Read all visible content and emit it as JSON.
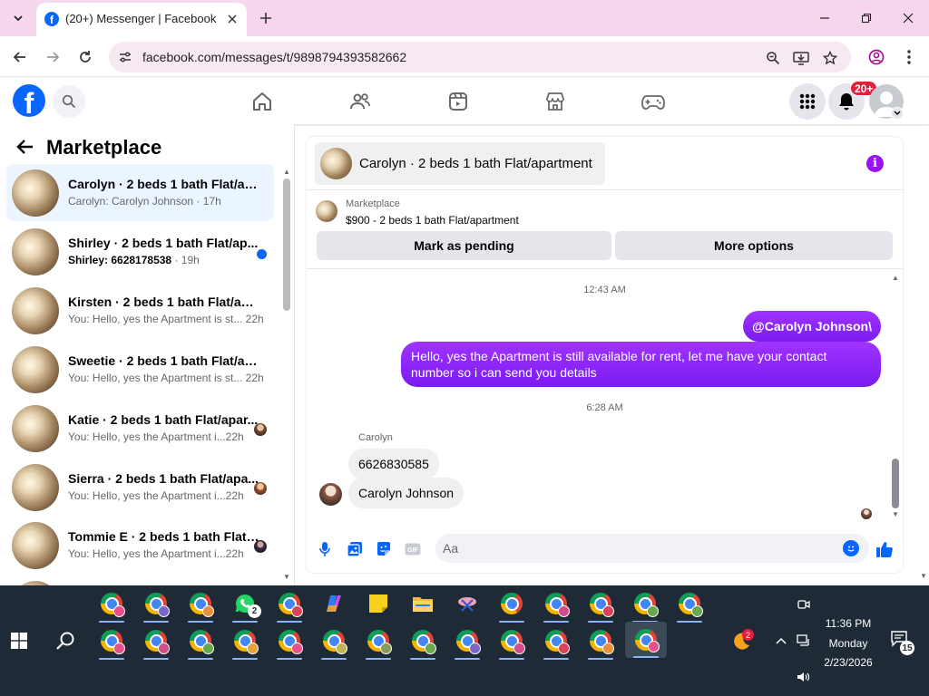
{
  "browser": {
    "tab": {
      "title": "(20+) Messenger | Facebook"
    },
    "url": "facebook.com/messages/t/9898794393582662"
  },
  "fb_header": {
    "notification_badge": "20+",
    "brand_color": "#0866ff"
  },
  "sidebar": {
    "title": "Marketplace",
    "conversations": [
      {
        "name": "Carolyn · 2 beds 1 bath Flat/apa...",
        "preview": "Carolyn: Carolyn Johnson",
        "time": "· 17h",
        "active": true
      },
      {
        "name": "Shirley · 2 beds 1 bath Flat/ap...",
        "preview": "Shirley: 6628178538",
        "time": "· 19h",
        "unread": true
      },
      {
        "name": "Kirsten · 2 beds 1 bath Flat/apar...",
        "preview": "You: Hello, yes the Apartment is st...",
        "time": "22h"
      },
      {
        "name": "Sweetie · 2 beds 1 bath Flat/apa...",
        "preview": "You: Hello, yes the Apartment is st...",
        "time": "22h"
      },
      {
        "name": "Katie · 2 beds 1 bath Flat/apar...",
        "preview": "You: Hello, yes the Apartment i...",
        "time": "22h"
      },
      {
        "name": "Sierra · 2 beds 1 bath Flat/apa...",
        "preview": "You: Hello, yes the Apartment i...",
        "time": "22h"
      },
      {
        "name": "Tommie E · 2 beds 1 bath Flat/...",
        "preview": "You: Hello, yes the Apartment i...",
        "time": "22h"
      }
    ]
  },
  "chat": {
    "title": "Carolyn · 2 beds 1 bath Flat/apartment",
    "marketplace_label": "Marketplace",
    "listing": "$900 - 2 beds 1 bath Flat/apartment",
    "mark_pending": "Mark as pending",
    "more_options": "More options",
    "time1": "12:43 AM",
    "out_mention": "@Carolyn Johnson\\",
    "out_message": "Hello, yes the Apartment is still available for rent, let me have your contact number so i can send you details",
    "time2": "6:28 AM",
    "sender_name": "Carolyn",
    "in_message_1": "6626830585",
    "in_message_2": "Carolyn Johnson",
    "composer_placeholder": "Aa",
    "accent_color": "#8b1ef0"
  },
  "taskbar": {
    "whatsapp_badge": "2",
    "weather_badge": "2",
    "clock_time": "11:36 PM",
    "clock_day": "Monday",
    "clock_date": "2/23/2026",
    "notification_count": "15"
  }
}
